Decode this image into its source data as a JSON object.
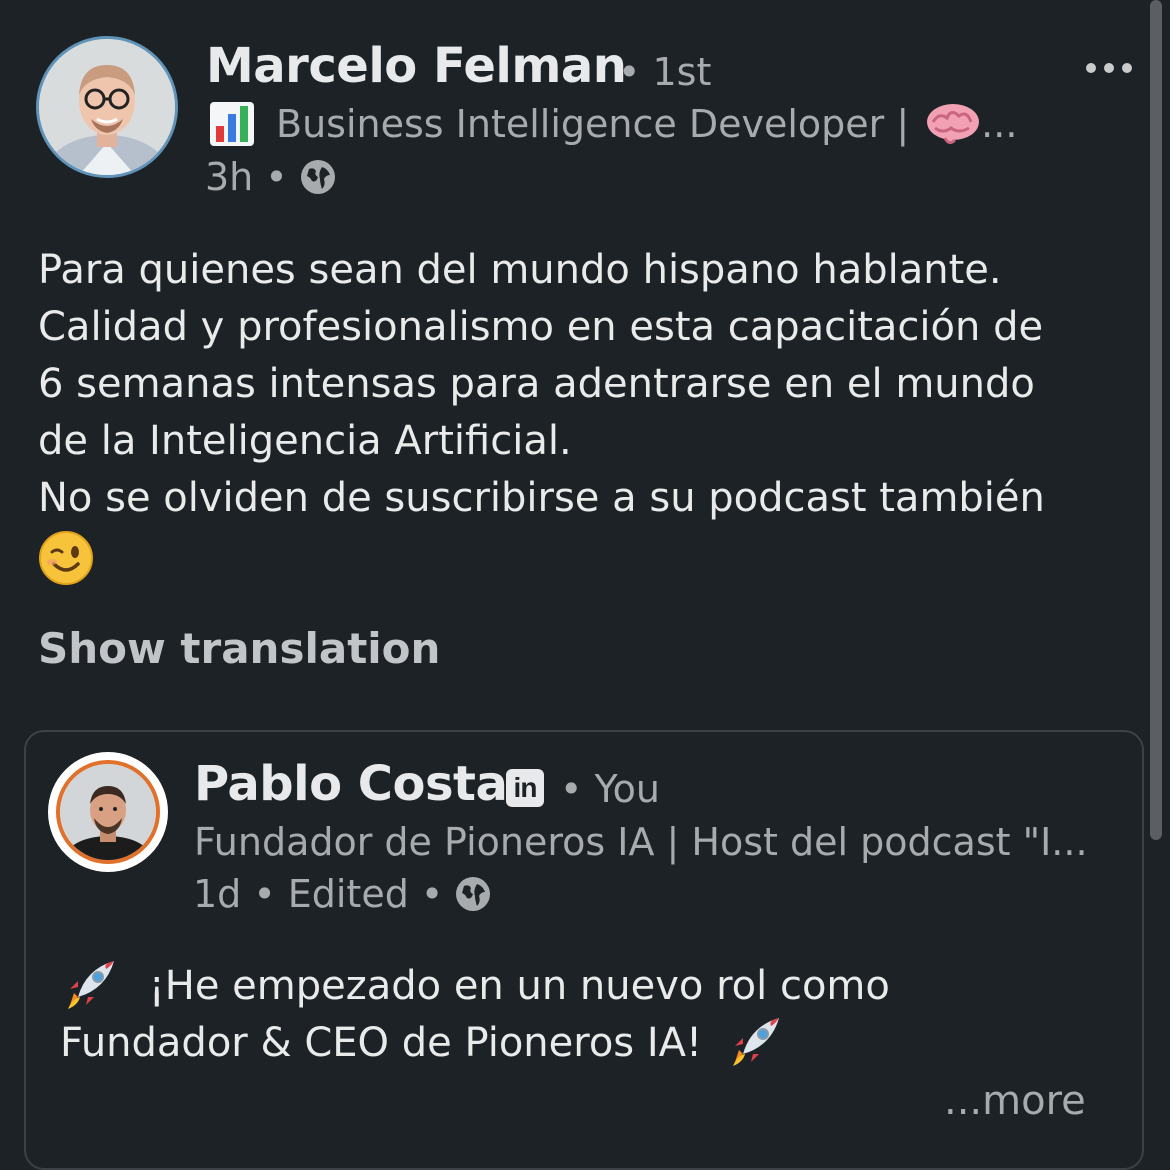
{
  "post": {
    "author_name": "Marcelo Felman",
    "degree": "• 1st",
    "headline": "Business Intelligence Developer |",
    "headline_emoji_1": "bar-chart-icon",
    "headline_emoji_2": "brain-icon",
    "headline_ellipsis": "...",
    "time": "3h",
    "separator": "•",
    "visibility_icon": "globe-icon",
    "body_lines": [
      "Para quienes sean del mundo hispano hablante.",
      "Calidad y profesionalismo en esta capacitación de",
      "6 semanas intensas para adentrarse en el mundo",
      "de la Inteligencia Artificial.",
      "No se olviden de suscribirse a su podcast también"
    ],
    "body_emoji": "winking-face-icon",
    "show_translation": "Show translation",
    "more_menu_icon": "more-horizontal-icon"
  },
  "shared": {
    "author_name": "Pablo Costa",
    "linkedin_badge": "in",
    "relation": "• You",
    "headline": "Fundador de Pioneros IA | Host del podcast \"I...",
    "time": "1d",
    "edited": "Edited",
    "separator": "•",
    "visibility_icon": "globe-icon",
    "body_line_1": "¡He empezado en un nuevo rol como",
    "body_line_2": "Fundador & CEO de Pioneros IA!",
    "body_emoji": "rocket-icon",
    "more": "...more"
  },
  "colors": {
    "background": "#1d2226",
    "primary_text": "#e9eaea",
    "secondary_text": "#a8abad",
    "card_border": "#3b4146",
    "avatar_ring_main": "#5f93b8",
    "avatar_ring_shared": "#e0702a"
  }
}
